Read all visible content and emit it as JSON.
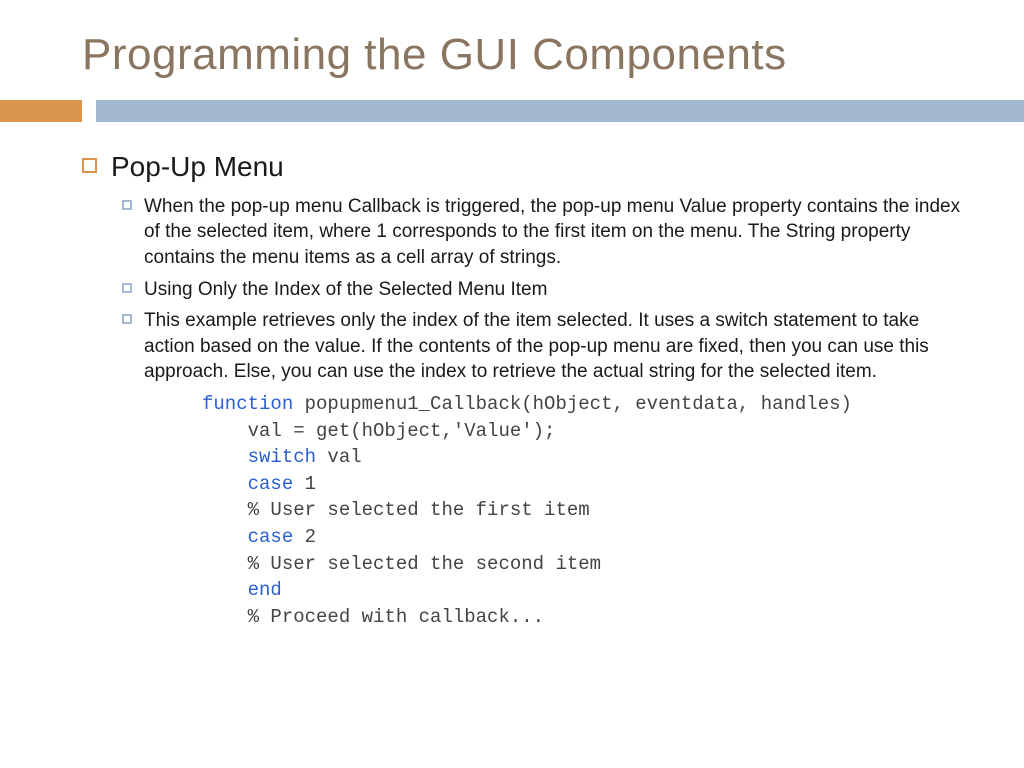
{
  "title": "Programming the GUI Components",
  "section": {
    "heading": "Pop-Up Menu"
  },
  "bullets": {
    "b1": "When the pop-up menu Callback is triggered, the pop-up menu Value property contains the index of the selected item, where 1 corresponds to the first item on the menu. The String property contains the menu items as a cell array of strings.",
    "b2": "Using Only the Index of the Selected Menu Item",
    "b3": "This example retrieves only the index of the item selected. It uses a switch statement to take action based on the value. If the contents of the pop-up menu are fixed, then you can use this approach. Else, you can use the index to retrieve the actual string for the selected item."
  },
  "code": {
    "l1a": "function",
    "l1b": " popupmenu1_Callback(hObject, eventdata, handles)",
    "l2": "    val = get(hObject,'Value');",
    "l3a": "    ",
    "l3b": "switch",
    "l3c": " val",
    "l4a": "    ",
    "l4b": "case",
    "l4c": " 1",
    "l5": "    % User selected the first item",
    "l6a": "    ",
    "l6b": "case",
    "l6c": " 2",
    "l7": "    % User selected the second item",
    "l8a": "    ",
    "l8b": "end",
    "l9": "    % Proceed with callback..."
  }
}
